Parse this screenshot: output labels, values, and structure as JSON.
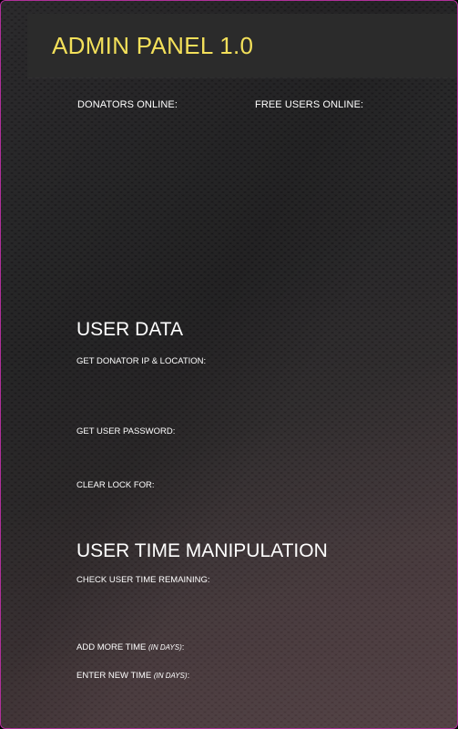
{
  "header": {
    "title": "ADMIN PANEL 1.0"
  },
  "online": {
    "donators_label": "DONATORS ONLINE:",
    "free_users_label": "FREE USERS ONLINE:"
  },
  "user_data": {
    "title": "USER DATA",
    "get_donator_ip_label": "GET DONATOR IP & LOCATION:",
    "get_user_password_label": "GET USER PASSWORD:",
    "clear_lock_label": "CLEAR LOCK FOR:"
  },
  "time_manipulation": {
    "title": "USER TIME MANIPULATION",
    "check_time_label": "CHECK USER TIME REMAINING:",
    "add_time_label": "ADD MORE TIME ",
    "add_time_unit": "(IN DAYS)",
    "add_time_colon": ":",
    "new_time_label": "ENTER NEW TIME ",
    "new_time_unit": "(IN DAYS)",
    "new_time_colon": ":"
  },
  "colors": {
    "title_yellow": "#f3e05a",
    "header_bar": "#2b2b2b",
    "border_magenta": "#b0309a"
  }
}
